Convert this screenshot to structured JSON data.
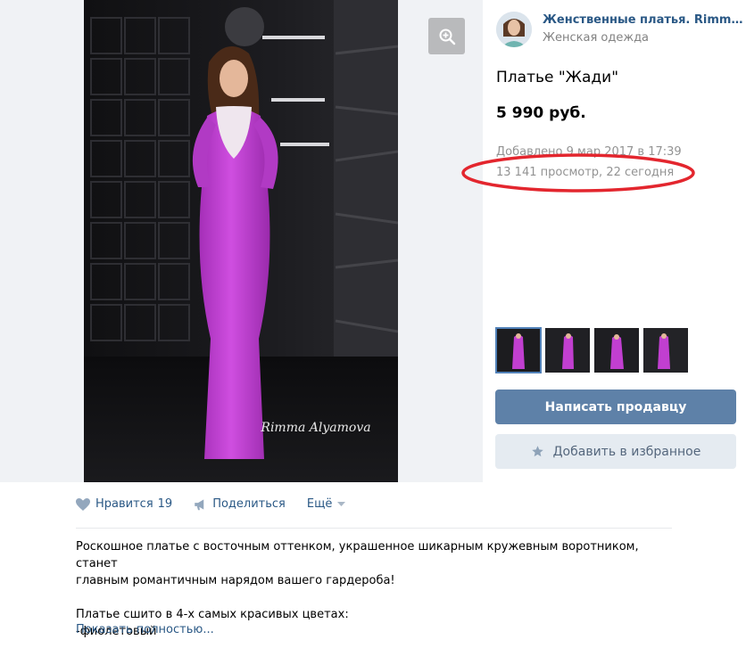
{
  "seller": {
    "name": "Женственные платья. Rimma Al...",
    "category": "Женская одежда"
  },
  "product": {
    "title": "Платье \"Жади\"",
    "price": "5 990 руб.",
    "added": "Добавлено 9 мар 2017 в 17:39",
    "views": "13 141 просмотр, 22 сегодня"
  },
  "photo": {
    "signature": "Rimma Alyamova"
  },
  "buttons": {
    "write_seller": "Написать продавцу",
    "add_favorite": "Добавить в избранное"
  },
  "actions": {
    "like_label": "Нравится",
    "like_count": "19",
    "share_label": "Поделиться",
    "more_label": "Ещё"
  },
  "description": {
    "line1": "Роскошное платье с восточным оттенком, украшенное шикарным кружевным воротником, станет",
    "line2": "главным романтичным нарядом вашего гардероба!",
    "line3": "Платье сшито в 4-х самых красивых цветах:",
    "line4": "-фиолетовый",
    "show_more": "Показать полностью..."
  },
  "colors": {
    "link": "#2a5885",
    "primary_button": "#5e81a8",
    "secondary_button": "#e5ebf1",
    "dress": "#c13fd0",
    "annotation": "#e3262e"
  },
  "icons": {
    "zoom": "zoom-plus-icon",
    "like": "heart-icon",
    "share": "megaphone-icon",
    "more": "chevron-down-icon",
    "favorite": "star-icon"
  }
}
